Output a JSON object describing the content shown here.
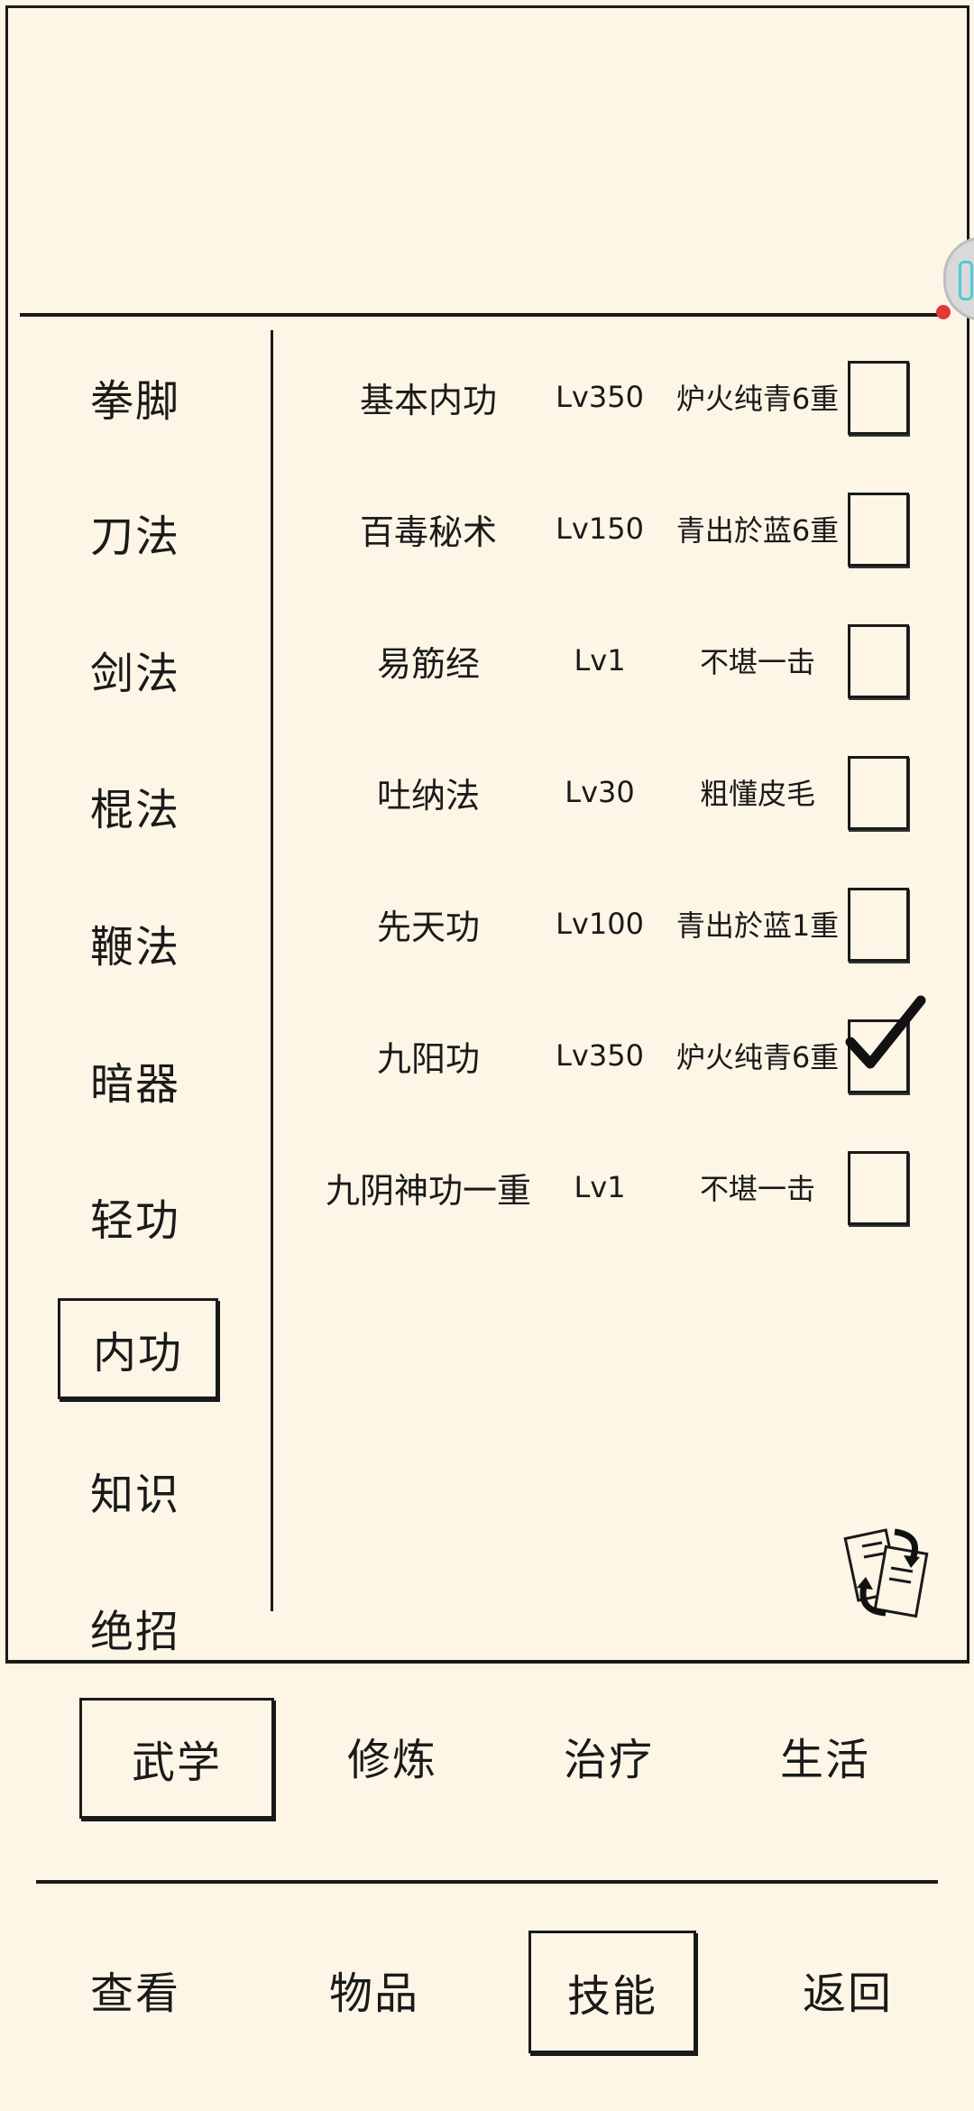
{
  "categories": [
    {
      "label": "拳脚"
    },
    {
      "label": "刀法"
    },
    {
      "label": "剑法"
    },
    {
      "label": "棍法"
    },
    {
      "label": "鞭法"
    },
    {
      "label": "暗器"
    },
    {
      "label": "轻功"
    },
    {
      "label": "内功",
      "selected": true
    },
    {
      "label": "知识"
    },
    {
      "label": "绝招"
    }
  ],
  "skills": [
    {
      "name": "基本内功",
      "level": "Lv350",
      "rank": "炉火纯青6重",
      "checked": false
    },
    {
      "name": "百毒秘术",
      "level": "Lv150",
      "rank": "青出於蓝6重",
      "checked": false
    },
    {
      "name": "易筋经",
      "level": "Lv1",
      "rank": "不堪一击",
      "checked": false
    },
    {
      "name": "吐纳法",
      "level": "Lv30",
      "rank": "粗懂皮毛",
      "checked": false
    },
    {
      "name": "先天功",
      "level": "Lv100",
      "rank": "青出於蓝1重",
      "checked": false
    },
    {
      "name": "九阳功",
      "level": "Lv350",
      "rank": "炉火纯青6重",
      "checked": true
    },
    {
      "name": "九阴神功一重",
      "level": "Lv1",
      "rank": "不堪一击",
      "checked": false
    }
  ],
  "subtabs": [
    {
      "label": "武学",
      "selected": true
    },
    {
      "label": "修炼"
    },
    {
      "label": "治疗"
    },
    {
      "label": "生活"
    }
  ],
  "nav": [
    {
      "label": "查看"
    },
    {
      "label": "物品"
    },
    {
      "label": "技能",
      "selected": true
    },
    {
      "label": "返回"
    }
  ],
  "icons": {
    "swap": "swap-cards-icon",
    "check": "checkmark-icon"
  }
}
